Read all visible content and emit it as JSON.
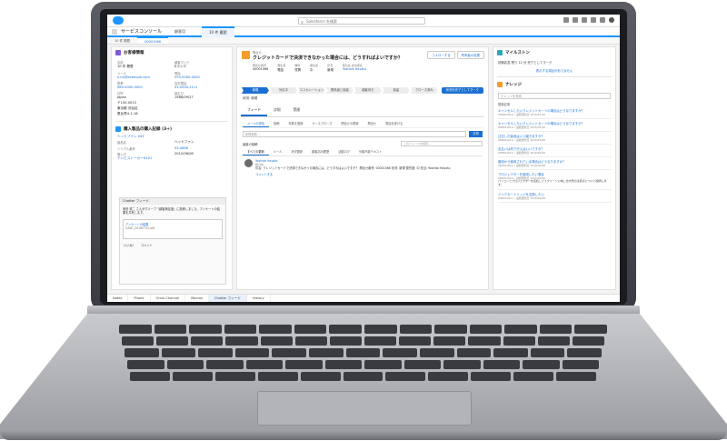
{
  "topbar": {
    "search_placeholder": "Salesforce を検索"
  },
  "navbar": {
    "app_name": "サービスコンソール",
    "nav_item": "顧客用",
    "active_tab": "10 件 履歴"
  },
  "subtabs": [
    "10 件 履歴",
    "00001066"
  ],
  "contact": {
    "header": "お客様情報",
    "fields": [
      {
        "label": "名前",
        "value": "10 件 履歴"
      },
      {
        "label": "顧客ランク",
        "value": "Kランク"
      },
      {
        "label": "メール",
        "value": "a.iro@example.com",
        "link": true
      },
      {
        "label": "電話",
        "value": "090-0000-0000",
        "link": true
      },
      {
        "label": "携帯",
        "value": "080-0000-0000",
        "link": true
      },
      {
        "label": "自宅電話",
        "value": "03-0000-1111",
        "link": true
      },
      {
        "label": "住所",
        "value": "Japan"
      },
      {
        "label": "誕生日",
        "value": "1988/09/27"
      },
      {
        "label": "",
        "value": "〒150-0013"
      },
      {
        "label": "",
        "value": "東京都 渋谷区"
      },
      {
        "label": "",
        "value": "恵比寿4-1-18"
      }
    ]
  },
  "product": {
    "header": "購入製品の購入記録 (3+)",
    "name": "ヘッドファン 043",
    "fields": [
      {
        "label": "製品名",
        "value": "ヘッドファン"
      },
      {
        "label": "シリアル番号",
        "value": "S3-0868"
      },
      {
        "label": "購入日",
        "value": "2012/06/06"
      }
    ],
    "second": "テレビストーカーH101"
  },
  "chatter_mini": {
    "title": "Chatter フィード",
    "post": "東田 慎二 さんがグループ「顧客満足度」に投稿しました。アンケートの結果を共有します。",
    "doc_title": "アンケートの結果",
    "doc_file": "CASE_20160720.pdf",
    "like": "いいね!",
    "comment": "コメント"
  },
  "case": {
    "label": "問合せ",
    "subject": "クレジットカードで決済できなかった場合には、どうすればよいですか？",
    "follow_btn": "フォローする",
    "owner_btn": "所有者の変更",
    "highlights": [
      {
        "label": "問合せ番号",
        "value": "00001066"
      },
      {
        "label": "発生源",
        "value": "電話"
      },
      {
        "label": "種別",
        "value": "質問"
      },
      {
        "label": "優先度",
        "value": "中"
      },
      {
        "label": "状況",
        "value": "新規"
      },
      {
        "label": "取引先 担当者名",
        "value": "Yoshida Hayato"
      }
    ],
    "path_steps": [
      "新規",
      "対応中",
      "エスカレーション",
      "関係者と協議",
      "顧客待ち",
      "保留",
      "クローズ済み"
    ],
    "path_button": "状況を完了としてマーク",
    "status_line": "状況: 新規"
  },
  "feed": {
    "tabs": [
      "フィード",
      "詳細",
      "関連"
    ],
    "publisher_tabs": [
      "メールの送信",
      "投稿",
      "件数を登録",
      "ケースクローズ",
      "問合せの更新",
      "問合せ",
      "電話を掛ける"
    ],
    "post_placeholder": "新規投稿...",
    "share": "共有",
    "sort_label": "最新の投稿",
    "search_placeholder": "このフィードを検索...",
    "types": [
      "すべての更新",
      "メール",
      "状況更新",
      "顧客応対履歴",
      "活動ログ",
      "分類不能テキスト"
    ],
    "post_author": "Yoshida Hayato",
    "post_time": "数分前",
    "post_text": "件名: クレジットカードで決済できなかった場合には、どうすればよいですか？ 問合せ番号: 00001066 状況: 新規 優先度: 中 担当: Yoshida Hayato",
    "comment_link": "コメントする"
  },
  "milestone": {
    "header": "マイルストン",
    "text": "初期応答 残り 12 分 完了としてマーク",
    "link": "表示する項目がありません"
  },
  "knowledge": {
    "header": "ナレッジ",
    "search_placeholder": "ナレッジを検索",
    "label": "推奨記事",
    "items": [
      {
        "title": "キャンセルしたいクレジットカードの場合はどうなりますか？",
        "meta": "000001018 • 最終更新日 2016/01/10",
        "snip": ""
      },
      {
        "title": "キャンセルしたいクレジットカードの場合はどうなりますか？",
        "meta": "000001019 • 最終更新日 2016/01/10",
        "snip": ""
      },
      {
        "title": "注文した製品はいつ届きますか？",
        "meta": "000001016 • 最終更新日 2016/01/06",
        "snip": ""
      },
      {
        "title": "支払いは何で行えばいいですか？",
        "meta": "000001015 • 最終更新日 2016/01/06",
        "snip": ""
      },
      {
        "title": "普段から使用されている場合はどうなりますか？",
        "meta": "000001014 • 最終更新日 2016/01/06",
        "snip": ""
      },
      {
        "title": "プロジェクターを使用したい場合",
        "meta": "000001012 • 最終更新日 2016/01/06",
        "snip": "パソコンとプロジェクターを接続してスクリーンに映し出す際の注意点について説明します。"
      },
      {
        "title": "インクカートリッジを交換したい",
        "meta": "000001011 • 最終更新日 2016/01/06",
        "snip": ""
      }
    ]
  },
  "utility": [
    "Notes",
    "Phone",
    "Omni-Channel",
    "Macros",
    "Chatter フィード",
    "History"
  ],
  "colors": {
    "brand": "#1b96ff",
    "link": "#1b6fd0",
    "case_icon": "#f59d2a"
  }
}
